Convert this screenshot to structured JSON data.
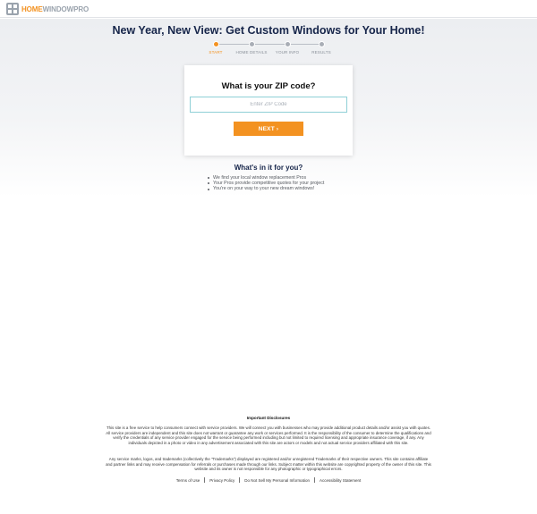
{
  "header": {
    "logo_home": "HOME",
    "logo_rest": "WINDOWPRO"
  },
  "hero": {
    "headline": "New Year, New View: Get Custom Windows for Your Home!"
  },
  "steps": [
    {
      "label": "START",
      "active": true
    },
    {
      "label": "HOME DETAILS",
      "active": false
    },
    {
      "label": "YOUR INFO",
      "active": false
    },
    {
      "label": "RESULTS",
      "active": false
    }
  ],
  "form": {
    "title": "What is your ZIP code?",
    "zip_placeholder": "Enter ZIP Code",
    "zip_value": "",
    "next_label": "NEXT ›"
  },
  "benefits": {
    "title": "What's in it for you?",
    "items": [
      "We find your local window replacement Pros",
      "Your Pros provide competitive quotes for your project",
      "You're on your way to your new dream windows!"
    ]
  },
  "disclosures": {
    "title": "Important Disclosures",
    "paragraph_1": "This site is a free service to help consumers connect with service providers. We will connect you with businesses who may provide additional product details and/or assist you with quotes. All service providers are independent and this site does not warrant or guarantee any work or services performed. It is the responsibility of the consumer to determine the qualifications and verify the credentials of any service provider engaged for the service being performed including but not limited to required licensing and appropriate insurance coverage, if any. Any individuals depicted in a photo or video in any advertisement associated with this site are actors or models and not actual service providers affiliated with this site.",
    "paragraph_2": "Any service marks, logos, and trademarks (collectively the \"Trademarks\") displayed are registered and/or unregistered Trademarks of their respective owners. This site contains affiliate and partner links and may receive compensation for referrals or purchases made through our links. Subject matter within this website are copyrighted property of the owner of this site. This website and its owner is not responsible for any photographic or typographical errors."
  },
  "footer": {
    "links": [
      "Terms of Use",
      "Privacy Policy",
      "Do Not Sell My Personal Information",
      "Accessibility Statement"
    ]
  },
  "colors": {
    "accent": "#f39221",
    "navy": "#16254a",
    "input_border": "#8fd0d6"
  }
}
